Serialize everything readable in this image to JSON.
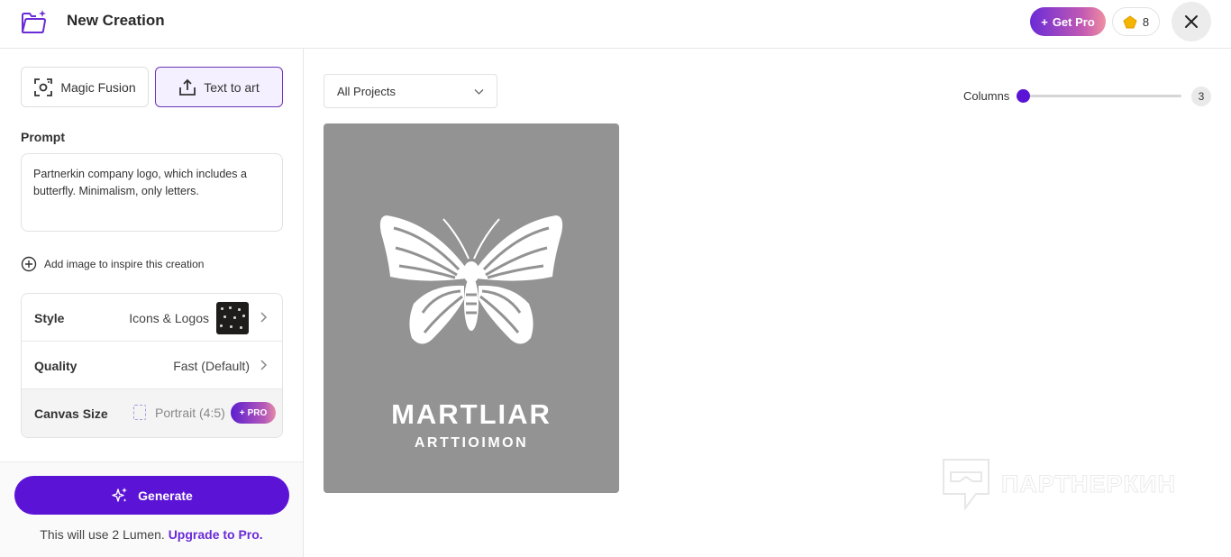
{
  "header": {
    "title": "New Creation",
    "get_pro_label": "Get Pro",
    "lumen_count": "8"
  },
  "left_panel": {
    "modes": [
      {
        "label": "Magic Fusion",
        "active": false
      },
      {
        "label": "Text to art",
        "active": true
      }
    ],
    "prompt": {
      "label": "Prompt",
      "value": "Partnerkin company logo, which includes a butterfly. Minimalism, only letters."
    },
    "add_image_label": "Add image to inspire this creation",
    "settings": {
      "style": {
        "label": "Style",
        "value": "Icons & Logos"
      },
      "quality": {
        "label": "Quality",
        "value": "Fast (Default)"
      },
      "canvas_size": {
        "label": "Canvas Size",
        "value": "Portrait (4:5)",
        "badge": "PRO"
      }
    },
    "generate_label": "Generate",
    "usage_text": "This will use 2 Lumen.",
    "upgrade_link": "Upgrade to Pro."
  },
  "main": {
    "project_filter": "All Projects",
    "columns_label": "Columns",
    "columns_value": "3",
    "artwork": {
      "brand_text": "MARTLIAR",
      "sub_text": "ARTTIOIMON"
    },
    "watermark_text": "ПАРТНЕРКИН"
  },
  "colors": {
    "accent": "#5b13d6",
    "art_background": "#939393"
  }
}
